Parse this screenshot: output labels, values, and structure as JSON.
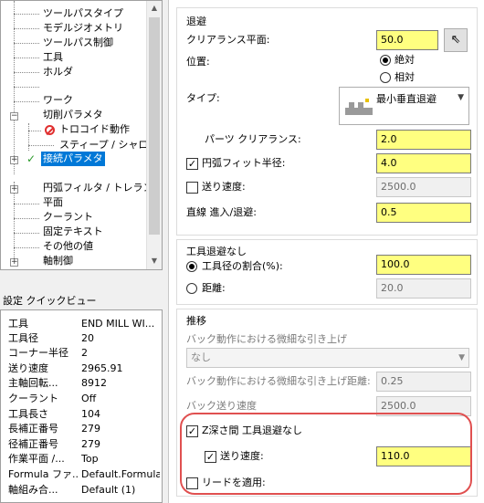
{
  "tree": {
    "items": [
      {
        "label": "ツールパスタイプ"
      },
      {
        "label": "モデルジオメトリ"
      },
      {
        "label": "ツールパス制御"
      },
      {
        "label": "工具"
      },
      {
        "label": "ホルダ"
      },
      {
        "label": "ワーク"
      },
      {
        "label": "切削パラメタ"
      },
      {
        "label": "トロコイド動作"
      },
      {
        "label": "スティープ / シャロー"
      },
      {
        "label": "接続パラメタ"
      },
      {
        "label": "円弧フィルタ / トレランス"
      },
      {
        "label": "平面"
      },
      {
        "label": "クーラント"
      },
      {
        "label": "固定テキスト"
      },
      {
        "label": "その他の値"
      },
      {
        "label": "軸制御"
      }
    ]
  },
  "quickview": {
    "title": "設定 クイックビュー",
    "rows": [
      {
        "k": "工具",
        "v": "END MILL WI..."
      },
      {
        "k": "工具径",
        "v": "20"
      },
      {
        "k": "コーナー半径",
        "v": "2"
      },
      {
        "k": "送り速度",
        "v": "2965.91"
      },
      {
        "k": "主軸回転...",
        "v": "8912"
      },
      {
        "k": "クーラント",
        "v": "Off"
      },
      {
        "k": "工具長さ",
        "v": "104"
      },
      {
        "k": "長補正番号",
        "v": "279"
      },
      {
        "k": "径補正番号",
        "v": "279"
      },
      {
        "k": "作業平面 /...",
        "v": "Top"
      },
      {
        "k": "Formula ファ...",
        "v": "Default.Formula"
      },
      {
        "k": "軸組み合...",
        "v": "Default (1)"
      }
    ]
  },
  "retract": {
    "title": "退避",
    "clearance_label": "クリアランス平面:",
    "clearance_value": "50.0",
    "position_label": "位置:",
    "absolute": "絶対",
    "incremental": "相対",
    "type_label": "タイプ:",
    "type_value": "最小垂直退避",
    "part_clearance_label": "パーツ クリアランス:",
    "part_clearance_value": "2.0",
    "arc_fit_label": "円弧フィット半径:",
    "arc_fit_value": "4.0",
    "feed_label": "送り速度:",
    "feed_value": "2500.0",
    "linear_label": "直線 進入/退避:",
    "linear_value": "0.5"
  },
  "no_retract": {
    "title": "工具退避なし",
    "tool_dia_label": "工具径の割合(%):",
    "tool_dia_value": "100.0",
    "distance_label": "距離:",
    "distance_value": "20.0"
  },
  "transition": {
    "title": "推移",
    "back_micro_label": "バック動作における微細な引き上げ",
    "back_micro_select": "なし",
    "back_micro_dist_label": "バック動作における微細な引き上げ距離:",
    "back_micro_dist_value": "0.25",
    "back_feed_label": "バック送り速度",
    "back_feed_value": "2500.0",
    "z_depth_label": "Z深さ間 工具退避なし",
    "z_feed_label": "送り速度:",
    "z_feed_value": "110.0",
    "apply_lead_label": "リードを適用:"
  },
  "colors": {
    "highlight": "#e05050",
    "required_field": "#ffff80",
    "selection": "#0078d7"
  }
}
